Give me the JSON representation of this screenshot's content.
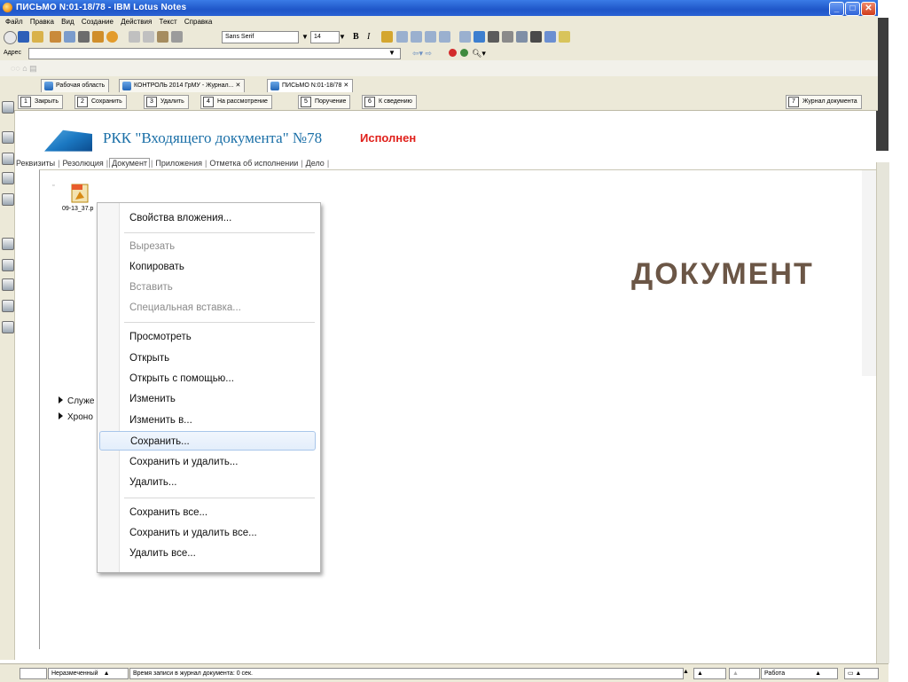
{
  "window": {
    "title": "ПИСЬМО N:01-18/78 - IBM Lotus Notes",
    "controls": [
      "minimize",
      "maximize",
      "close"
    ]
  },
  "menubar": [
    "Файл",
    "Правка",
    "Вид",
    "Создание",
    "Действия",
    "Текст",
    "Справка"
  ],
  "toolbar": {
    "font_name": "Sans Serif",
    "font_size": "14",
    "bold": "B",
    "italic": "I"
  },
  "address_bar": {
    "label": "Адрес",
    "value": ""
  },
  "doc_tabs": [
    {
      "label": "Рабочая область"
    },
    {
      "label": "КОНТРОЛЬ 2014 ГрМУ - Журнал..."
    },
    {
      "label": "ПИСЬМО N:01-18/78"
    }
  ],
  "actions": [
    {
      "num": "1",
      "label": "Закрыть"
    },
    {
      "num": "2",
      "label": "Сохранить"
    },
    {
      "num": "3",
      "label": "Удалить"
    },
    {
      "num": "4",
      "label": "На рассмотрение"
    },
    {
      "num": "5",
      "label": "Поручение"
    },
    {
      "num": "6",
      "label": "К сведению"
    },
    {
      "num": "7",
      "label": "Журнал документа"
    }
  ],
  "header": {
    "title": "РКК \"Входящего документа\" №78",
    "status": "Исполнен"
  },
  "subtabs": [
    "Реквизиты",
    "Резолюция",
    "Документ",
    "Приложения",
    "Отметка об исполнении",
    "Дело"
  ],
  "active_subtab": "Документ",
  "attachment": {
    "name": "09-13_37.p",
    "type": "PDF"
  },
  "sections": [
    "Служе",
    "Хроно"
  ],
  "overlay_label": "ДОКУМЕНТ",
  "context_menu": {
    "groups": [
      [
        {
          "label": "Свойства вложения...",
          "disabled": false
        }
      ],
      [
        {
          "label": "Вырезать",
          "disabled": true
        },
        {
          "label": "Копировать",
          "disabled": false
        },
        {
          "label": "Вставить",
          "disabled": true
        },
        {
          "label": "Специальная вставка...",
          "disabled": true
        }
      ],
      [
        {
          "label": "Просмотреть",
          "disabled": false
        },
        {
          "label": "Открыть",
          "disabled": false
        },
        {
          "label": "Открыть с помощью...",
          "disabled": false
        },
        {
          "label": "Изменить",
          "disabled": false
        },
        {
          "label": "Изменить в...",
          "disabled": false
        },
        {
          "label": "Сохранить...",
          "disabled": false,
          "selected": true
        },
        {
          "label": "Сохранить и удалить...",
          "disabled": false
        },
        {
          "label": "Удалить...",
          "disabled": false
        }
      ],
      [
        {
          "label": "Сохранить все...",
          "disabled": false
        },
        {
          "label": "Сохранить и удалить все...",
          "disabled": false
        },
        {
          "label": "Удалить все...",
          "disabled": false
        }
      ]
    ]
  },
  "statusbar": {
    "field1": "Неразмеченный",
    "field2": "Время записи в журнал документа: 0 сек.",
    "field3": "Работа"
  },
  "colors": {
    "title_bar": "#1f56c8",
    "header_title": "#1a6fa7",
    "status_red": "#e0201b",
    "overlay_brown": "#6b5646",
    "chrome": "#ece9d8"
  }
}
